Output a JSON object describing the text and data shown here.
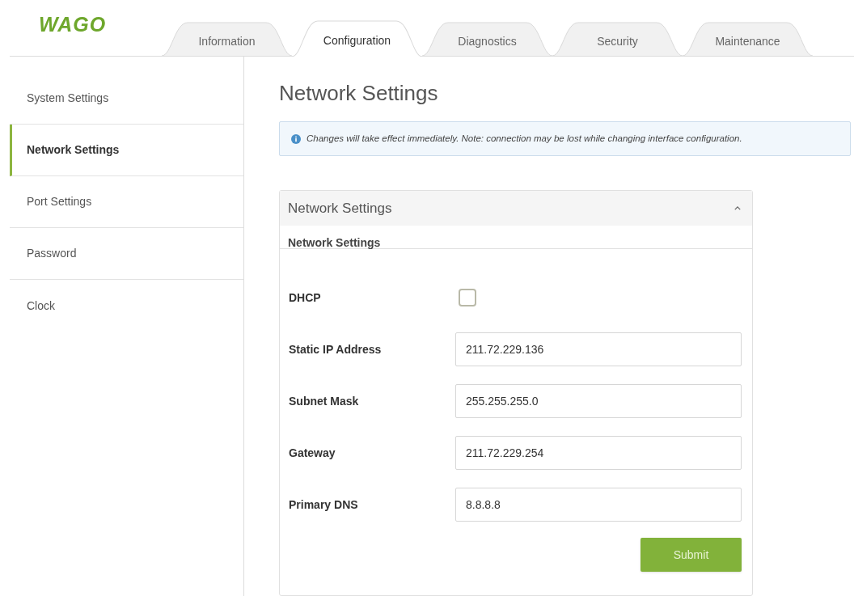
{
  "logo": "WAGO",
  "tabs": [
    {
      "label": "Information",
      "selected": false
    },
    {
      "label": "Configuration",
      "selected": true
    },
    {
      "label": "Diagnostics",
      "selected": false
    },
    {
      "label": "Security",
      "selected": false
    },
    {
      "label": "Maintenance",
      "selected": false
    }
  ],
  "sidebar": {
    "items": [
      {
        "label": "System Settings",
        "selected": false
      },
      {
        "label": "Network Settings",
        "selected": true
      },
      {
        "label": "Port Settings",
        "selected": false
      },
      {
        "label": "Password",
        "selected": false
      },
      {
        "label": "Clock",
        "selected": false
      }
    ]
  },
  "page_title": "Network Settings",
  "alert": {
    "text": "Changes will take effect immediately. Note: connection may be lost while changing interface configuration."
  },
  "panel": {
    "title": "Network Settings",
    "expanded": true,
    "section": "Network Settings",
    "fields": [
      {
        "kind": "checkbox",
        "label": "DHCP",
        "checked": false
      },
      {
        "kind": "text",
        "label": "Static IP Address",
        "value": "211.72.229.136"
      },
      {
        "kind": "text",
        "label": "Subnet Mask",
        "value": "255.255.255.0"
      },
      {
        "kind": "text",
        "label": "Gateway",
        "value": "211.72.229.254"
      },
      {
        "kind": "text",
        "label": "Primary DNS",
        "value": "8.8.8.8"
      }
    ],
    "submit": "Submit"
  }
}
